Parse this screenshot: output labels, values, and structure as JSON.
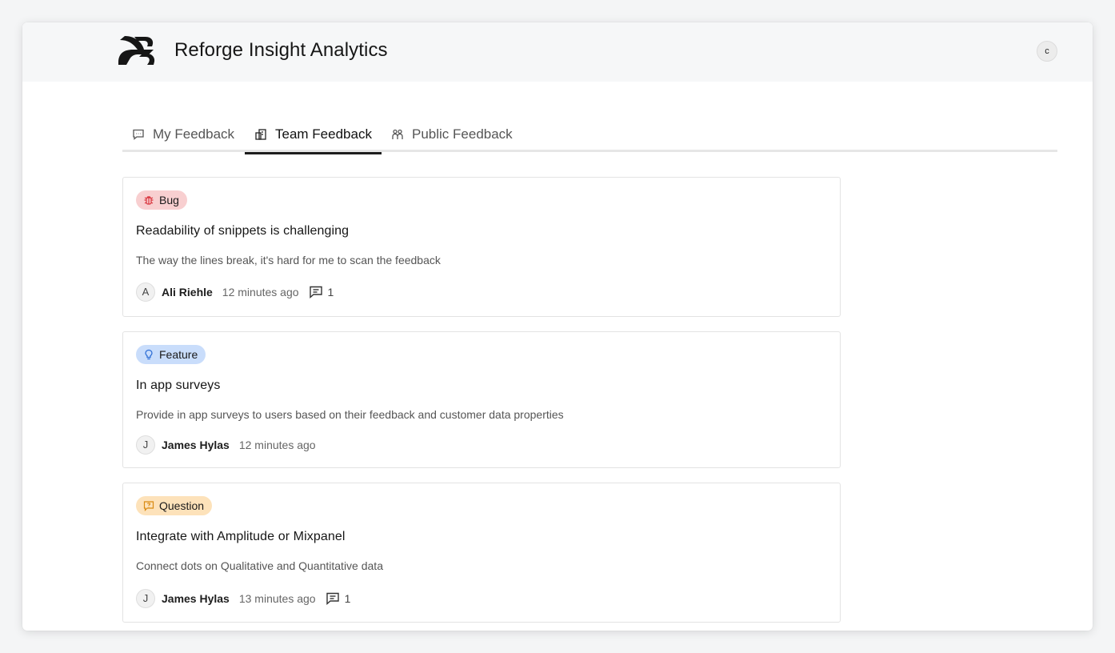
{
  "app": {
    "title": "Reforge Insight Analytics",
    "user_initial": "c"
  },
  "tabs": [
    {
      "label": "My Feedback",
      "icon": "chat-icon",
      "active": false
    },
    {
      "label": "Team Feedback",
      "icon": "team-icon",
      "active": true
    },
    {
      "label": "Public Feedback",
      "icon": "people-icon",
      "active": false
    }
  ],
  "feedback": [
    {
      "type": "Bug",
      "type_icon": "bug-icon",
      "type_color": "#f8cfd0",
      "title": "Readability of snippets is challenging",
      "description": "The way the lines break, it's hard for me to scan the feedback",
      "author_initial": "A",
      "author": "Ali Riehle",
      "time": "12 minutes ago",
      "comments": "1"
    },
    {
      "type": "Feature",
      "type_icon": "lightbulb-icon",
      "type_color": "#c9ddfb",
      "title": "In app surveys",
      "description": "Provide in app surveys to users based on their feedback and customer data properties",
      "author_initial": "J",
      "author": "James Hylas",
      "time": "12 minutes ago"
    },
    {
      "type": "Question",
      "type_icon": "question-icon",
      "type_color": "#fde2ba",
      "title": "Integrate with Amplitude or Mixpanel",
      "description": "Connect dots on Qualitative and Quantitative data",
      "author_initial": "J",
      "author": "James Hylas",
      "time": "13 minutes ago",
      "comments": "1"
    }
  ]
}
